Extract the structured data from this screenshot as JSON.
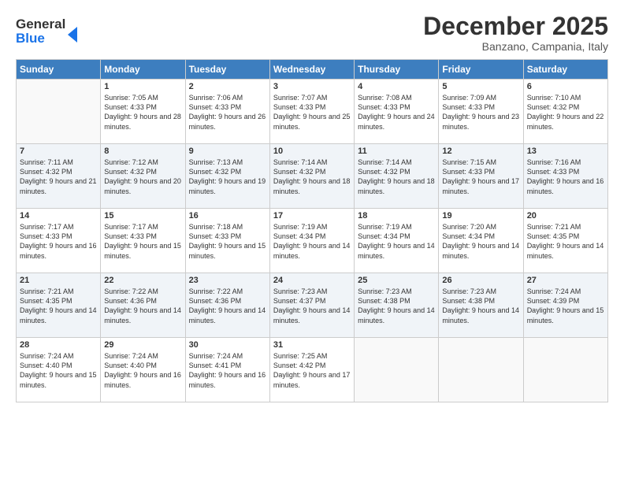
{
  "logo": {
    "line1": "General",
    "line2": "Blue"
  },
  "title": "December 2025",
  "location": "Banzano, Campania, Italy",
  "days_of_week": [
    "Sunday",
    "Monday",
    "Tuesday",
    "Wednesday",
    "Thursday",
    "Friday",
    "Saturday"
  ],
  "weeks": [
    [
      {
        "day": "",
        "sunrise": "",
        "sunset": "",
        "daylight": ""
      },
      {
        "day": "1",
        "sunrise": "Sunrise: 7:05 AM",
        "sunset": "Sunset: 4:33 PM",
        "daylight": "Daylight: 9 hours and 28 minutes."
      },
      {
        "day": "2",
        "sunrise": "Sunrise: 7:06 AM",
        "sunset": "Sunset: 4:33 PM",
        "daylight": "Daylight: 9 hours and 26 minutes."
      },
      {
        "day": "3",
        "sunrise": "Sunrise: 7:07 AM",
        "sunset": "Sunset: 4:33 PM",
        "daylight": "Daylight: 9 hours and 25 minutes."
      },
      {
        "day": "4",
        "sunrise": "Sunrise: 7:08 AM",
        "sunset": "Sunset: 4:33 PM",
        "daylight": "Daylight: 9 hours and 24 minutes."
      },
      {
        "day": "5",
        "sunrise": "Sunrise: 7:09 AM",
        "sunset": "Sunset: 4:33 PM",
        "daylight": "Daylight: 9 hours and 23 minutes."
      },
      {
        "day": "6",
        "sunrise": "Sunrise: 7:10 AM",
        "sunset": "Sunset: 4:32 PM",
        "daylight": "Daylight: 9 hours and 22 minutes."
      }
    ],
    [
      {
        "day": "7",
        "sunrise": "Sunrise: 7:11 AM",
        "sunset": "Sunset: 4:32 PM",
        "daylight": "Daylight: 9 hours and 21 minutes."
      },
      {
        "day": "8",
        "sunrise": "Sunrise: 7:12 AM",
        "sunset": "Sunset: 4:32 PM",
        "daylight": "Daylight: 9 hours and 20 minutes."
      },
      {
        "day": "9",
        "sunrise": "Sunrise: 7:13 AM",
        "sunset": "Sunset: 4:32 PM",
        "daylight": "Daylight: 9 hours and 19 minutes."
      },
      {
        "day": "10",
        "sunrise": "Sunrise: 7:14 AM",
        "sunset": "Sunset: 4:32 PM",
        "daylight": "Daylight: 9 hours and 18 minutes."
      },
      {
        "day": "11",
        "sunrise": "Sunrise: 7:14 AM",
        "sunset": "Sunset: 4:32 PM",
        "daylight": "Daylight: 9 hours and 18 minutes."
      },
      {
        "day": "12",
        "sunrise": "Sunrise: 7:15 AM",
        "sunset": "Sunset: 4:33 PM",
        "daylight": "Daylight: 9 hours and 17 minutes."
      },
      {
        "day": "13",
        "sunrise": "Sunrise: 7:16 AM",
        "sunset": "Sunset: 4:33 PM",
        "daylight": "Daylight: 9 hours and 16 minutes."
      }
    ],
    [
      {
        "day": "14",
        "sunrise": "Sunrise: 7:17 AM",
        "sunset": "Sunset: 4:33 PM",
        "daylight": "Daylight: 9 hours and 16 minutes."
      },
      {
        "day": "15",
        "sunrise": "Sunrise: 7:17 AM",
        "sunset": "Sunset: 4:33 PM",
        "daylight": "Daylight: 9 hours and 15 minutes."
      },
      {
        "day": "16",
        "sunrise": "Sunrise: 7:18 AM",
        "sunset": "Sunset: 4:33 PM",
        "daylight": "Daylight: 9 hours and 15 minutes."
      },
      {
        "day": "17",
        "sunrise": "Sunrise: 7:19 AM",
        "sunset": "Sunset: 4:34 PM",
        "daylight": "Daylight: 9 hours and 14 minutes."
      },
      {
        "day": "18",
        "sunrise": "Sunrise: 7:19 AM",
        "sunset": "Sunset: 4:34 PM",
        "daylight": "Daylight: 9 hours and 14 minutes."
      },
      {
        "day": "19",
        "sunrise": "Sunrise: 7:20 AM",
        "sunset": "Sunset: 4:34 PM",
        "daylight": "Daylight: 9 hours and 14 minutes."
      },
      {
        "day": "20",
        "sunrise": "Sunrise: 7:21 AM",
        "sunset": "Sunset: 4:35 PM",
        "daylight": "Daylight: 9 hours and 14 minutes."
      }
    ],
    [
      {
        "day": "21",
        "sunrise": "Sunrise: 7:21 AM",
        "sunset": "Sunset: 4:35 PM",
        "daylight": "Daylight: 9 hours and 14 minutes."
      },
      {
        "day": "22",
        "sunrise": "Sunrise: 7:22 AM",
        "sunset": "Sunset: 4:36 PM",
        "daylight": "Daylight: 9 hours and 14 minutes."
      },
      {
        "day": "23",
        "sunrise": "Sunrise: 7:22 AM",
        "sunset": "Sunset: 4:36 PM",
        "daylight": "Daylight: 9 hours and 14 minutes."
      },
      {
        "day": "24",
        "sunrise": "Sunrise: 7:23 AM",
        "sunset": "Sunset: 4:37 PM",
        "daylight": "Daylight: 9 hours and 14 minutes."
      },
      {
        "day": "25",
        "sunrise": "Sunrise: 7:23 AM",
        "sunset": "Sunset: 4:38 PM",
        "daylight": "Daylight: 9 hours and 14 minutes."
      },
      {
        "day": "26",
        "sunrise": "Sunrise: 7:23 AM",
        "sunset": "Sunset: 4:38 PM",
        "daylight": "Daylight: 9 hours and 14 minutes."
      },
      {
        "day": "27",
        "sunrise": "Sunrise: 7:24 AM",
        "sunset": "Sunset: 4:39 PM",
        "daylight": "Daylight: 9 hours and 15 minutes."
      }
    ],
    [
      {
        "day": "28",
        "sunrise": "Sunrise: 7:24 AM",
        "sunset": "Sunset: 4:40 PM",
        "daylight": "Daylight: 9 hours and 15 minutes."
      },
      {
        "day": "29",
        "sunrise": "Sunrise: 7:24 AM",
        "sunset": "Sunset: 4:40 PM",
        "daylight": "Daylight: 9 hours and 16 minutes."
      },
      {
        "day": "30",
        "sunrise": "Sunrise: 7:24 AM",
        "sunset": "Sunset: 4:41 PM",
        "daylight": "Daylight: 9 hours and 16 minutes."
      },
      {
        "day": "31",
        "sunrise": "Sunrise: 7:25 AM",
        "sunset": "Sunset: 4:42 PM",
        "daylight": "Daylight: 9 hours and 17 minutes."
      },
      {
        "day": "",
        "sunrise": "",
        "sunset": "",
        "daylight": ""
      },
      {
        "day": "",
        "sunrise": "",
        "sunset": "",
        "daylight": ""
      },
      {
        "day": "",
        "sunrise": "",
        "sunset": "",
        "daylight": ""
      }
    ]
  ]
}
